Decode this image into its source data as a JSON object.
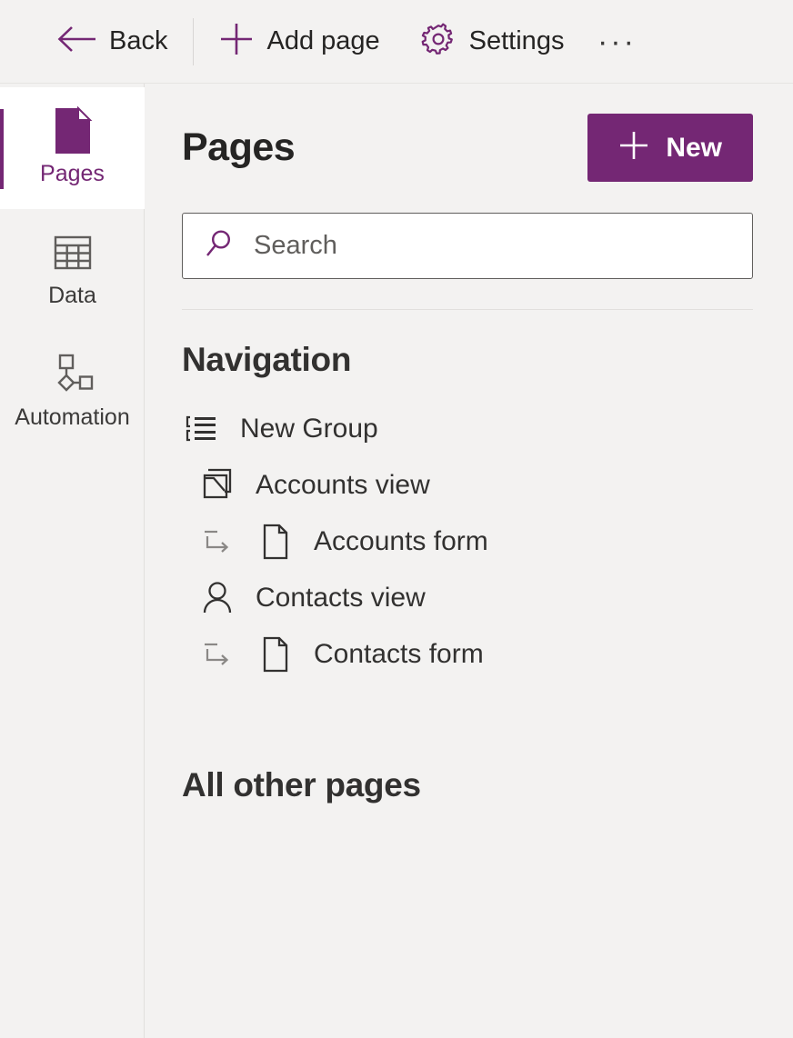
{
  "colors": {
    "accent": "#742774",
    "surface": "#f3f2f1",
    "text": "#252423",
    "muted": "#605e5c",
    "white": "#ffffff"
  },
  "toolbar": {
    "back": {
      "label": "Back",
      "icon": "arrow-left-icon"
    },
    "add_page": {
      "label": "Add page",
      "icon": "plus-icon"
    },
    "settings": {
      "label": "Settings",
      "icon": "gear-icon"
    },
    "overflow": {
      "label": "···",
      "icon": "ellipsis-icon"
    }
  },
  "rail": {
    "items": [
      {
        "label": "Pages",
        "icon": "page-icon",
        "selected": true
      },
      {
        "label": "Data",
        "icon": "table-icon",
        "selected": false
      },
      {
        "label": "Automation",
        "icon": "flowchart-icon",
        "selected": false
      }
    ]
  },
  "main": {
    "title": "Pages",
    "new_button": {
      "label": "New",
      "icon": "plus-icon"
    },
    "search": {
      "value": "",
      "placeholder": "Search",
      "icon": "search-icon"
    },
    "navigation": {
      "heading": "Navigation",
      "items": [
        {
          "label": "New Group",
          "icon": "group-list-icon",
          "indented": false,
          "sub": false
        },
        {
          "label": "Accounts view",
          "icon": "entity-view-icon",
          "indented": true,
          "sub": false
        },
        {
          "label": "Accounts form",
          "icon": "page-outline-icon",
          "indented": true,
          "sub": true
        },
        {
          "label": "Contacts view",
          "icon": "person-icon",
          "indented": true,
          "sub": false
        },
        {
          "label": "Contacts form",
          "icon": "page-outline-icon",
          "indented": true,
          "sub": true
        }
      ]
    },
    "all_other_pages": {
      "heading": "All other pages"
    }
  }
}
